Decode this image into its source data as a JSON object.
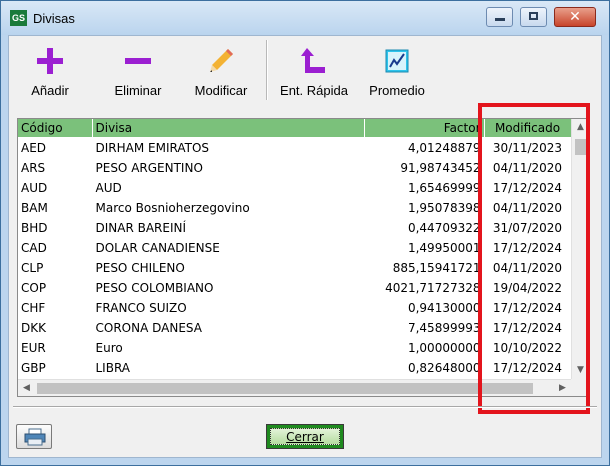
{
  "window": {
    "title": "Divisas",
    "app_icon_text": "GS"
  },
  "toolbar": {
    "buttons": [
      {
        "label": "Añadir",
        "icon": "plus-icon"
      },
      {
        "label": "Eliminar",
        "icon": "minus-icon"
      },
      {
        "label": "Modificar",
        "icon": "pencil-icon"
      },
      {
        "label": "Ent. Rápida",
        "icon": "quick-entry-arrow-icon"
      },
      {
        "label": "Promedio",
        "icon": "chart-line-icon"
      }
    ]
  },
  "grid": {
    "columns": [
      "Código",
      "Divisa",
      "Factor",
      "Modificado"
    ],
    "header_color": "#7bc17b",
    "rows": [
      {
        "code": "AED",
        "name": "DIRHAM EMIRATOS",
        "factor": "4,01248879",
        "modified": "30/11/2023"
      },
      {
        "code": "ARS",
        "name": "PESO ARGENTINO",
        "factor": "91,98743452",
        "modified": "04/11/2020"
      },
      {
        "code": "AUD",
        "name": "AUD",
        "factor": "1,65469999",
        "modified": "17/12/2024"
      },
      {
        "code": "BAM",
        "name": "Marco Bosnioherzegovino",
        "factor": "1,95078398",
        "modified": "04/11/2020"
      },
      {
        "code": "BHD",
        "name": "DINAR BAREINÍ",
        "factor": "0,44709322",
        "modified": "31/07/2020"
      },
      {
        "code": "CAD",
        "name": "DOLAR CANADIENSE",
        "factor": "1,49950001",
        "modified": "17/12/2024"
      },
      {
        "code": "CLP",
        "name": "PESO CHILENO",
        "factor": "885,15941721",
        "modified": "04/11/2020"
      },
      {
        "code": "COP",
        "name": "PESO COLOMBIANO",
        "factor": "4021,71727328",
        "modified": "19/04/2022"
      },
      {
        "code": "CHF",
        "name": "FRANCO SUIZO",
        "factor": "0,94130000",
        "modified": "17/12/2024"
      },
      {
        "code": "DKK",
        "name": "CORONA DANESA",
        "factor": "7,45899993",
        "modified": "17/12/2024"
      },
      {
        "code": "EUR",
        "name": "Euro",
        "factor": "1,00000000",
        "modified": "10/10/2022"
      },
      {
        "code": "GBP",
        "name": "LIBRA",
        "factor": "0,82648000",
        "modified": "17/12/2024"
      }
    ],
    "highlight_color": "#e3141c"
  },
  "footer": {
    "print_icon": "printer-icon",
    "close_label": "Cerrar",
    "close_button_color": "#1f8a1f"
  }
}
